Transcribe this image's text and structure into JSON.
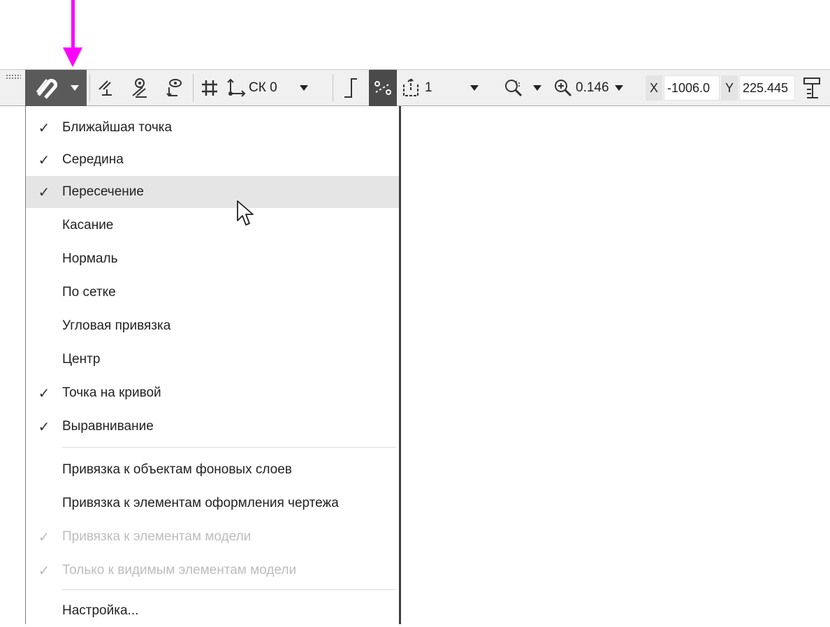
{
  "toolbar": {
    "coordinate_system": "СК 0",
    "layer_value": "1",
    "zoom_value": "0.146",
    "x_label": "X",
    "x_value": "-1006.0",
    "y_label": "Y",
    "y_value": "225.445"
  },
  "menu": {
    "items": [
      {
        "label": "Ближайшая точка",
        "checked": true,
        "enabled": true
      },
      {
        "label": "Середина",
        "checked": true,
        "enabled": true
      },
      {
        "label": "Пересечение",
        "checked": true,
        "enabled": true,
        "hovered": true
      },
      {
        "label": "Касание",
        "checked": false,
        "enabled": true
      },
      {
        "label": "Нормаль",
        "checked": false,
        "enabled": true
      },
      {
        "label": "По сетке",
        "checked": false,
        "enabled": true
      },
      {
        "label": "Угловая привязка",
        "checked": false,
        "enabled": true
      },
      {
        "label": "Центр",
        "checked": false,
        "enabled": true
      },
      {
        "label": "Точка на кривой",
        "checked": true,
        "enabled": true
      },
      {
        "label": "Выравнивание",
        "checked": true,
        "enabled": true
      },
      {
        "label": "Привязка к объектам фоновых слоев",
        "checked": false,
        "enabled": true
      },
      {
        "label": "Привязка к элементам оформления чертежа",
        "checked": false,
        "enabled": true
      },
      {
        "label": "Привязка к элементам модели",
        "checked": true,
        "enabled": false
      },
      {
        "label": "Только к видимым элементам модели",
        "checked": true,
        "enabled": false
      },
      {
        "label": "Настройка...",
        "checked": false,
        "enabled": true
      }
    ],
    "check_mark": "✓"
  },
  "colors": {
    "pointer_arrow": "#ff00ff",
    "hover_row": "#e5e5e5",
    "active_tool": "#5a5a5a"
  },
  "icons": [
    "snap-magnet-icon",
    "parallel-icon",
    "tangent-eye-icon",
    "point-eye-icon",
    "grid-icon",
    "ucs-axes-icon",
    "ortho-icon",
    "snap-points-icon",
    "layer-icon",
    "magnifier-icon",
    "zoom-icon",
    "ruler-icon",
    "mouse-cursor-icon"
  ]
}
